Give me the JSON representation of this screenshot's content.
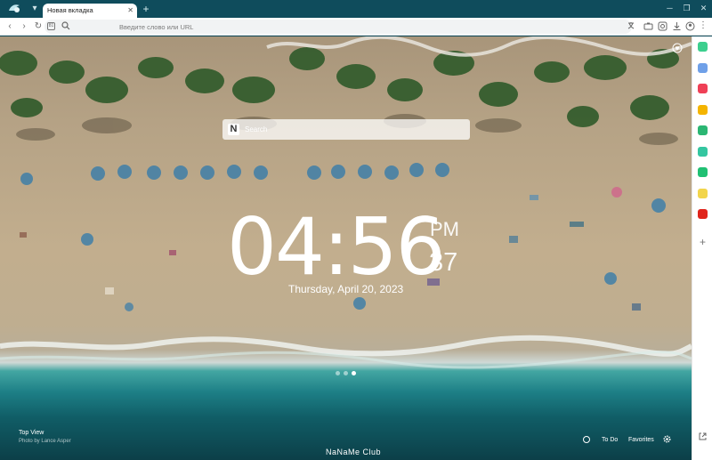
{
  "window": {
    "tab_title": "Новая вкладка",
    "new_tab_icon": "plus-icon",
    "controls": [
      "minimize-icon",
      "restore-icon",
      "close-icon"
    ]
  },
  "toolbar": {
    "address_placeholder": "Введите слово или URL"
  },
  "newtab": {
    "search_placeholder": "Search",
    "search_logo": "N",
    "clock": {
      "time": "04:56",
      "ampm": "PM",
      "seconds": "37",
      "date": "Thursday, April 20, 2023"
    },
    "carousel": {
      "count": 3,
      "active_index": 2
    },
    "photo_title": "Top View",
    "photo_credit": "Photo by Lance Asper",
    "watermark": "NaNaMe Club",
    "footer": {
      "todo_label": "To Do",
      "favorites_label": "Favorites"
    }
  },
  "sidebar": {
    "icons": [
      {
        "name": "chat-icon",
        "color": "#3ccf8e"
      },
      {
        "name": "apps-icon",
        "color": "#6fa0e8"
      },
      {
        "name": "pocket-icon",
        "color": "#ef4056"
      },
      {
        "name": "star-icon",
        "color": "#f4b400"
      },
      {
        "name": "translate-icon",
        "color": "#2bb673"
      },
      {
        "name": "vpn-icon",
        "color": "#34c6a0"
      },
      {
        "name": "wallet-icon",
        "color": "#20c073"
      },
      {
        "name": "notes-icon",
        "color": "#f2d54b"
      },
      {
        "name": "youtube-icon",
        "color": "#e0241b"
      }
    ]
  },
  "colors": {
    "titlebar": "#0f4c5c",
    "sand": "#c2ae8e",
    "sea": "#1d7f86"
  }
}
